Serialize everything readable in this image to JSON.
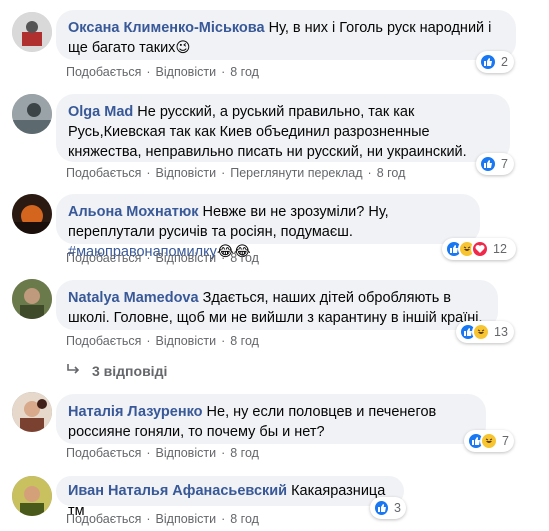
{
  "labels": {
    "like": "Подобається",
    "reply": "Відповісти",
    "translate": "Переглянути переклад"
  },
  "comments": [
    {
      "author": "Оксана Клименко-Міськова",
      "text": "Ну, в них і Гоголь руск народний і ще багато таких😉",
      "time": "8 год",
      "reactions": [
        "like"
      ],
      "count": "2"
    },
    {
      "author": "Olga Mad",
      "text": "Не русский, а руський правильно, так как Русь,Киевская так как Киев объединил разрозненные княжества, неправильно писать ни русский, ни украинский.",
      "time": "8 год",
      "reactions": [
        "like"
      ],
      "count": "7"
    },
    {
      "author": "Альона Мохнатюк",
      "text": "Невже ви не зрозуміли? Ну, переплутали русичів та росіян, подумаєш. ",
      "hashtag": "#маюправонапомилку",
      "emoji": "😂😂",
      "time": "8 год",
      "reactions": [
        "like",
        "haha",
        "love"
      ],
      "count": "12"
    },
    {
      "author": "Natalya Mamedova",
      "text": "Здається, наших дітей обробляють в школі. Головне, щоб ми не вийшли з карантину в іншій країні.",
      "time": "8 год",
      "reactions": [
        "like",
        "haha"
      ],
      "count": "13"
    },
    {
      "author": "Наталія Лазуренко",
      "text": "Не, ну если половцев и печенегов россияне гоняли, то почему бы и нет?",
      "time": "8 год",
      "reactions": [
        "like",
        "haha"
      ],
      "count": "7"
    },
    {
      "author": "Иван Наталья Афанасьевский",
      "text": "Какаяразница тм",
      "time": "8 год",
      "reactions": [
        "like"
      ],
      "count": "3"
    }
  ],
  "replies_link": "3 відповіді"
}
